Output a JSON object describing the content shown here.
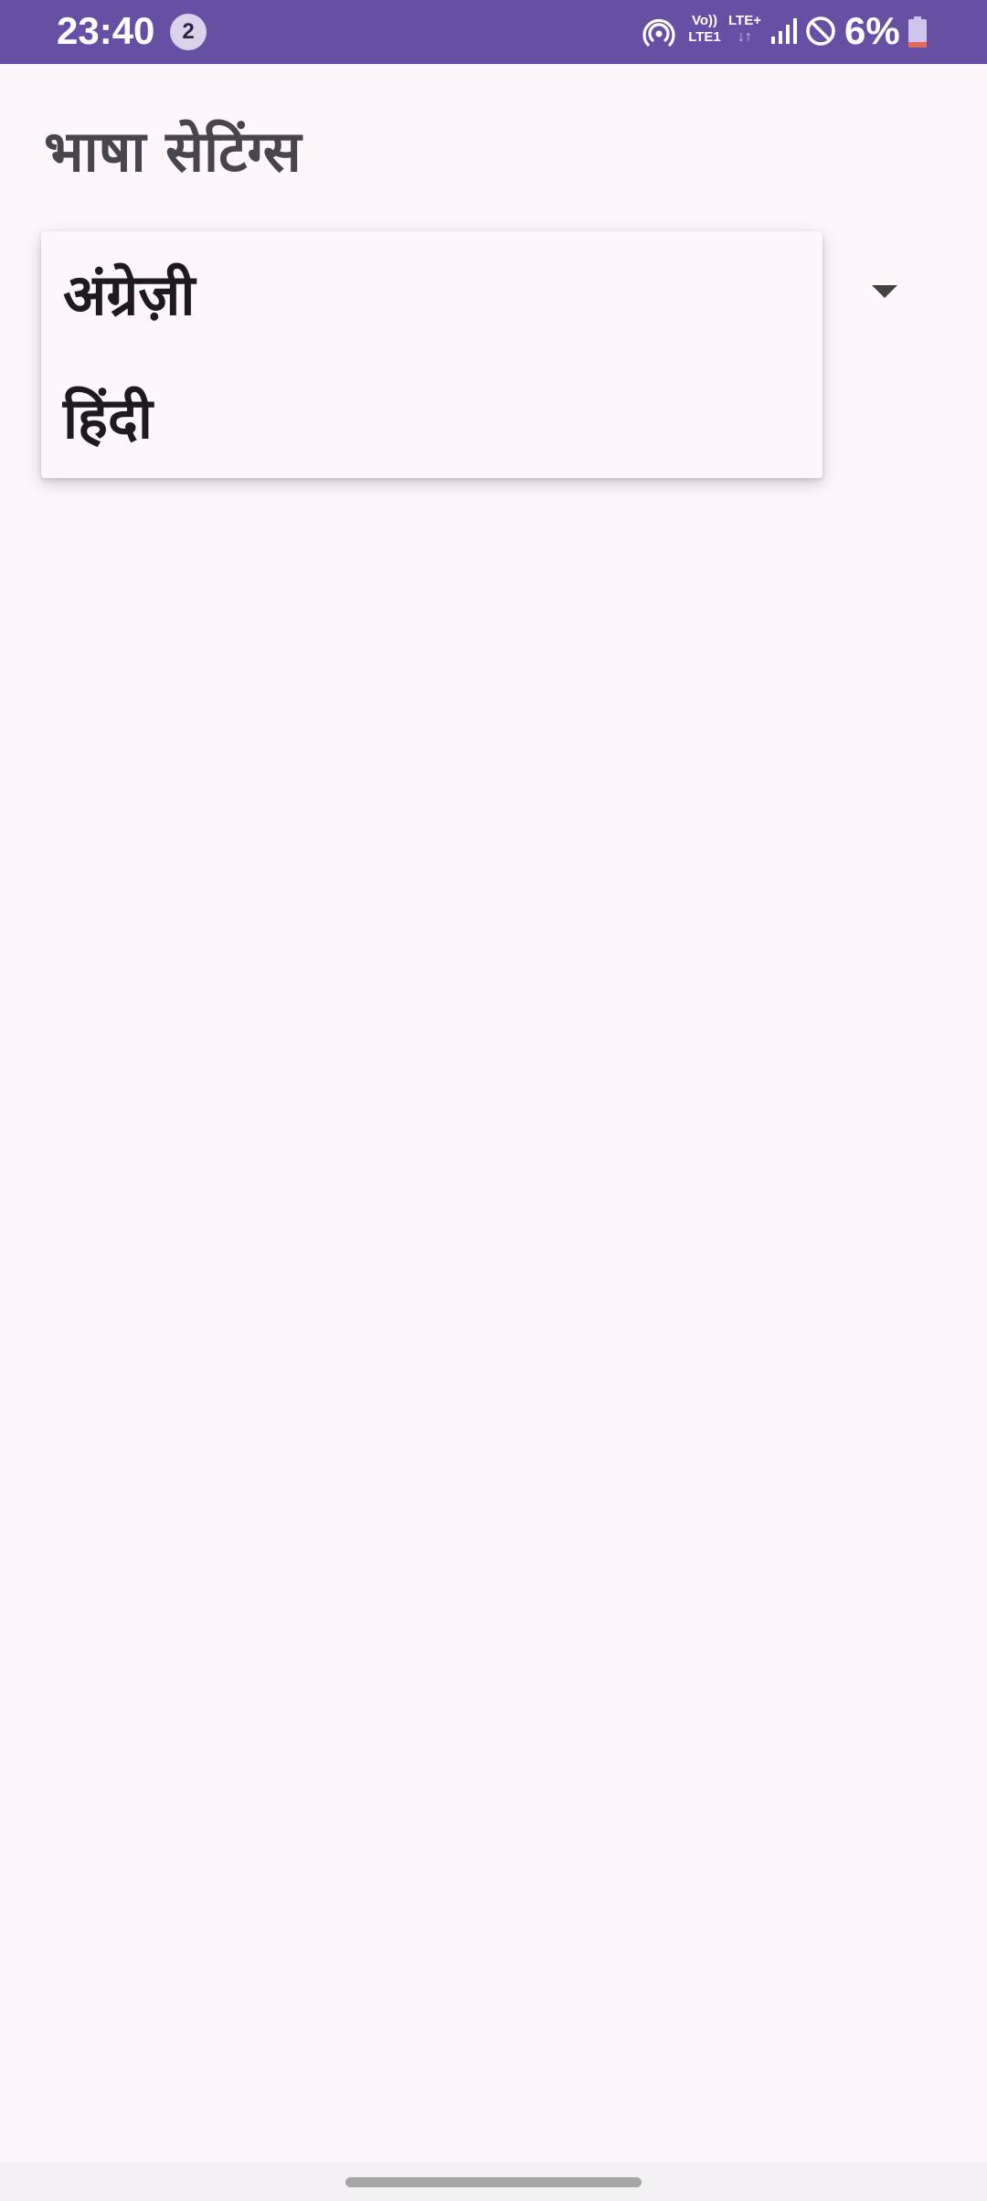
{
  "status_bar": {
    "time": "23:40",
    "notification_count": "2",
    "volte_top": "Vo))",
    "volte_bottom": "LTE1",
    "lte_label": "LTE+",
    "lte_arrows": "↓↑",
    "battery": "6%",
    "icons": [
      "hotspot-icon",
      "volte-icon",
      "lte-icon",
      "signal-icon",
      "dnd-icon",
      "battery-icon"
    ],
    "color": "#6750a4"
  },
  "header": {
    "title": "भाषा सेटिंग्स"
  },
  "language_dropdown": {
    "options": [
      {
        "label": "अंग्रेज़ी"
      },
      {
        "label": "हिंदी"
      }
    ],
    "arrow_icon": "caret-down-icon"
  },
  "colors": {
    "background": "#fdf7fc",
    "title_text": "#48464c",
    "item_text": "#1d1b20",
    "battery_low": "#e06a5c"
  }
}
